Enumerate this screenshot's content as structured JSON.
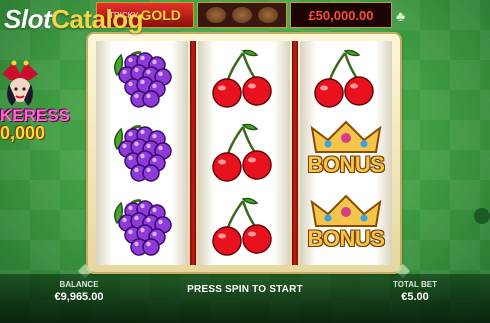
{
  "watermark": {
    "part1": "Slot",
    "part2": "Catalog"
  },
  "jackpot": {
    "tiny_label": "TRICKY",
    "name": "GOLD",
    "amount": "£50,000.00"
  },
  "side_promo": {
    "title": "KERESS",
    "prize": "0,000"
  },
  "reels": [
    [
      "grapes",
      "grapes",
      "grapes"
    ],
    [
      "cherries",
      "cherries",
      "cherries"
    ],
    [
      "cherries",
      "bonus",
      "bonus"
    ]
  ],
  "bonus_label": "BONUS",
  "footer": {
    "balance_label": "BALANCE",
    "balance_value": "€9,965.00",
    "message": "PRESS SPIN TO START",
    "total_bet_label": "TOTAL BET",
    "total_bet_value": "€5.00"
  },
  "colors": {
    "bg_green": "#3f9c42",
    "reel_separator": "#c81a1a",
    "jackpot_amount": "#ff4a3a",
    "gold": "#ffd23a"
  },
  "icons": [
    "club-icon",
    "gear-icon"
  ]
}
